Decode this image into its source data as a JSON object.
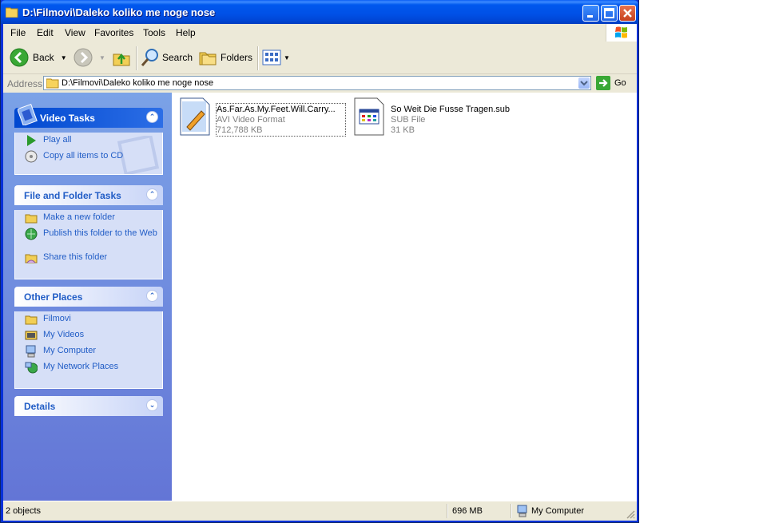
{
  "window": {
    "title": "D:\\Filmovi\\Daleko koliko me noge nose"
  },
  "menu": [
    "File",
    "Edit",
    "View",
    "Favorites",
    "Tools",
    "Help"
  ],
  "toolbar": {
    "back": "Back",
    "search": "Search",
    "folders": "Folders"
  },
  "address": {
    "label": "Address",
    "value": "D:\\Filmovi\\Daleko koliko me noge nose",
    "go": "Go"
  },
  "panels": {
    "video_tasks": {
      "title": "Video Tasks",
      "items": [
        "Play all",
        "Copy all items to CD"
      ]
    },
    "file_folder_tasks": {
      "title": "File and Folder Tasks",
      "items": [
        "Make a new folder",
        "Publish this folder to the Web",
        "Share this folder"
      ]
    },
    "other_places": {
      "title": "Other Places",
      "items": [
        "Filmovi",
        "My Videos",
        "My Computer",
        "My Network Places"
      ]
    },
    "details": {
      "title": "Details"
    }
  },
  "files": [
    {
      "name": "As.Far.As.My.Feet.Will.Carry...",
      "type": "AVI Video Format",
      "size": "712,788 KB",
      "icon": "video-file-icon"
    },
    {
      "name": "So Weit Die Fusse Tragen.sub",
      "type": "SUB File",
      "size": "31 KB",
      "icon": "sub-file-icon"
    }
  ],
  "status": {
    "objects": "2 objects",
    "free": "696 MB",
    "location": "My Computer"
  }
}
